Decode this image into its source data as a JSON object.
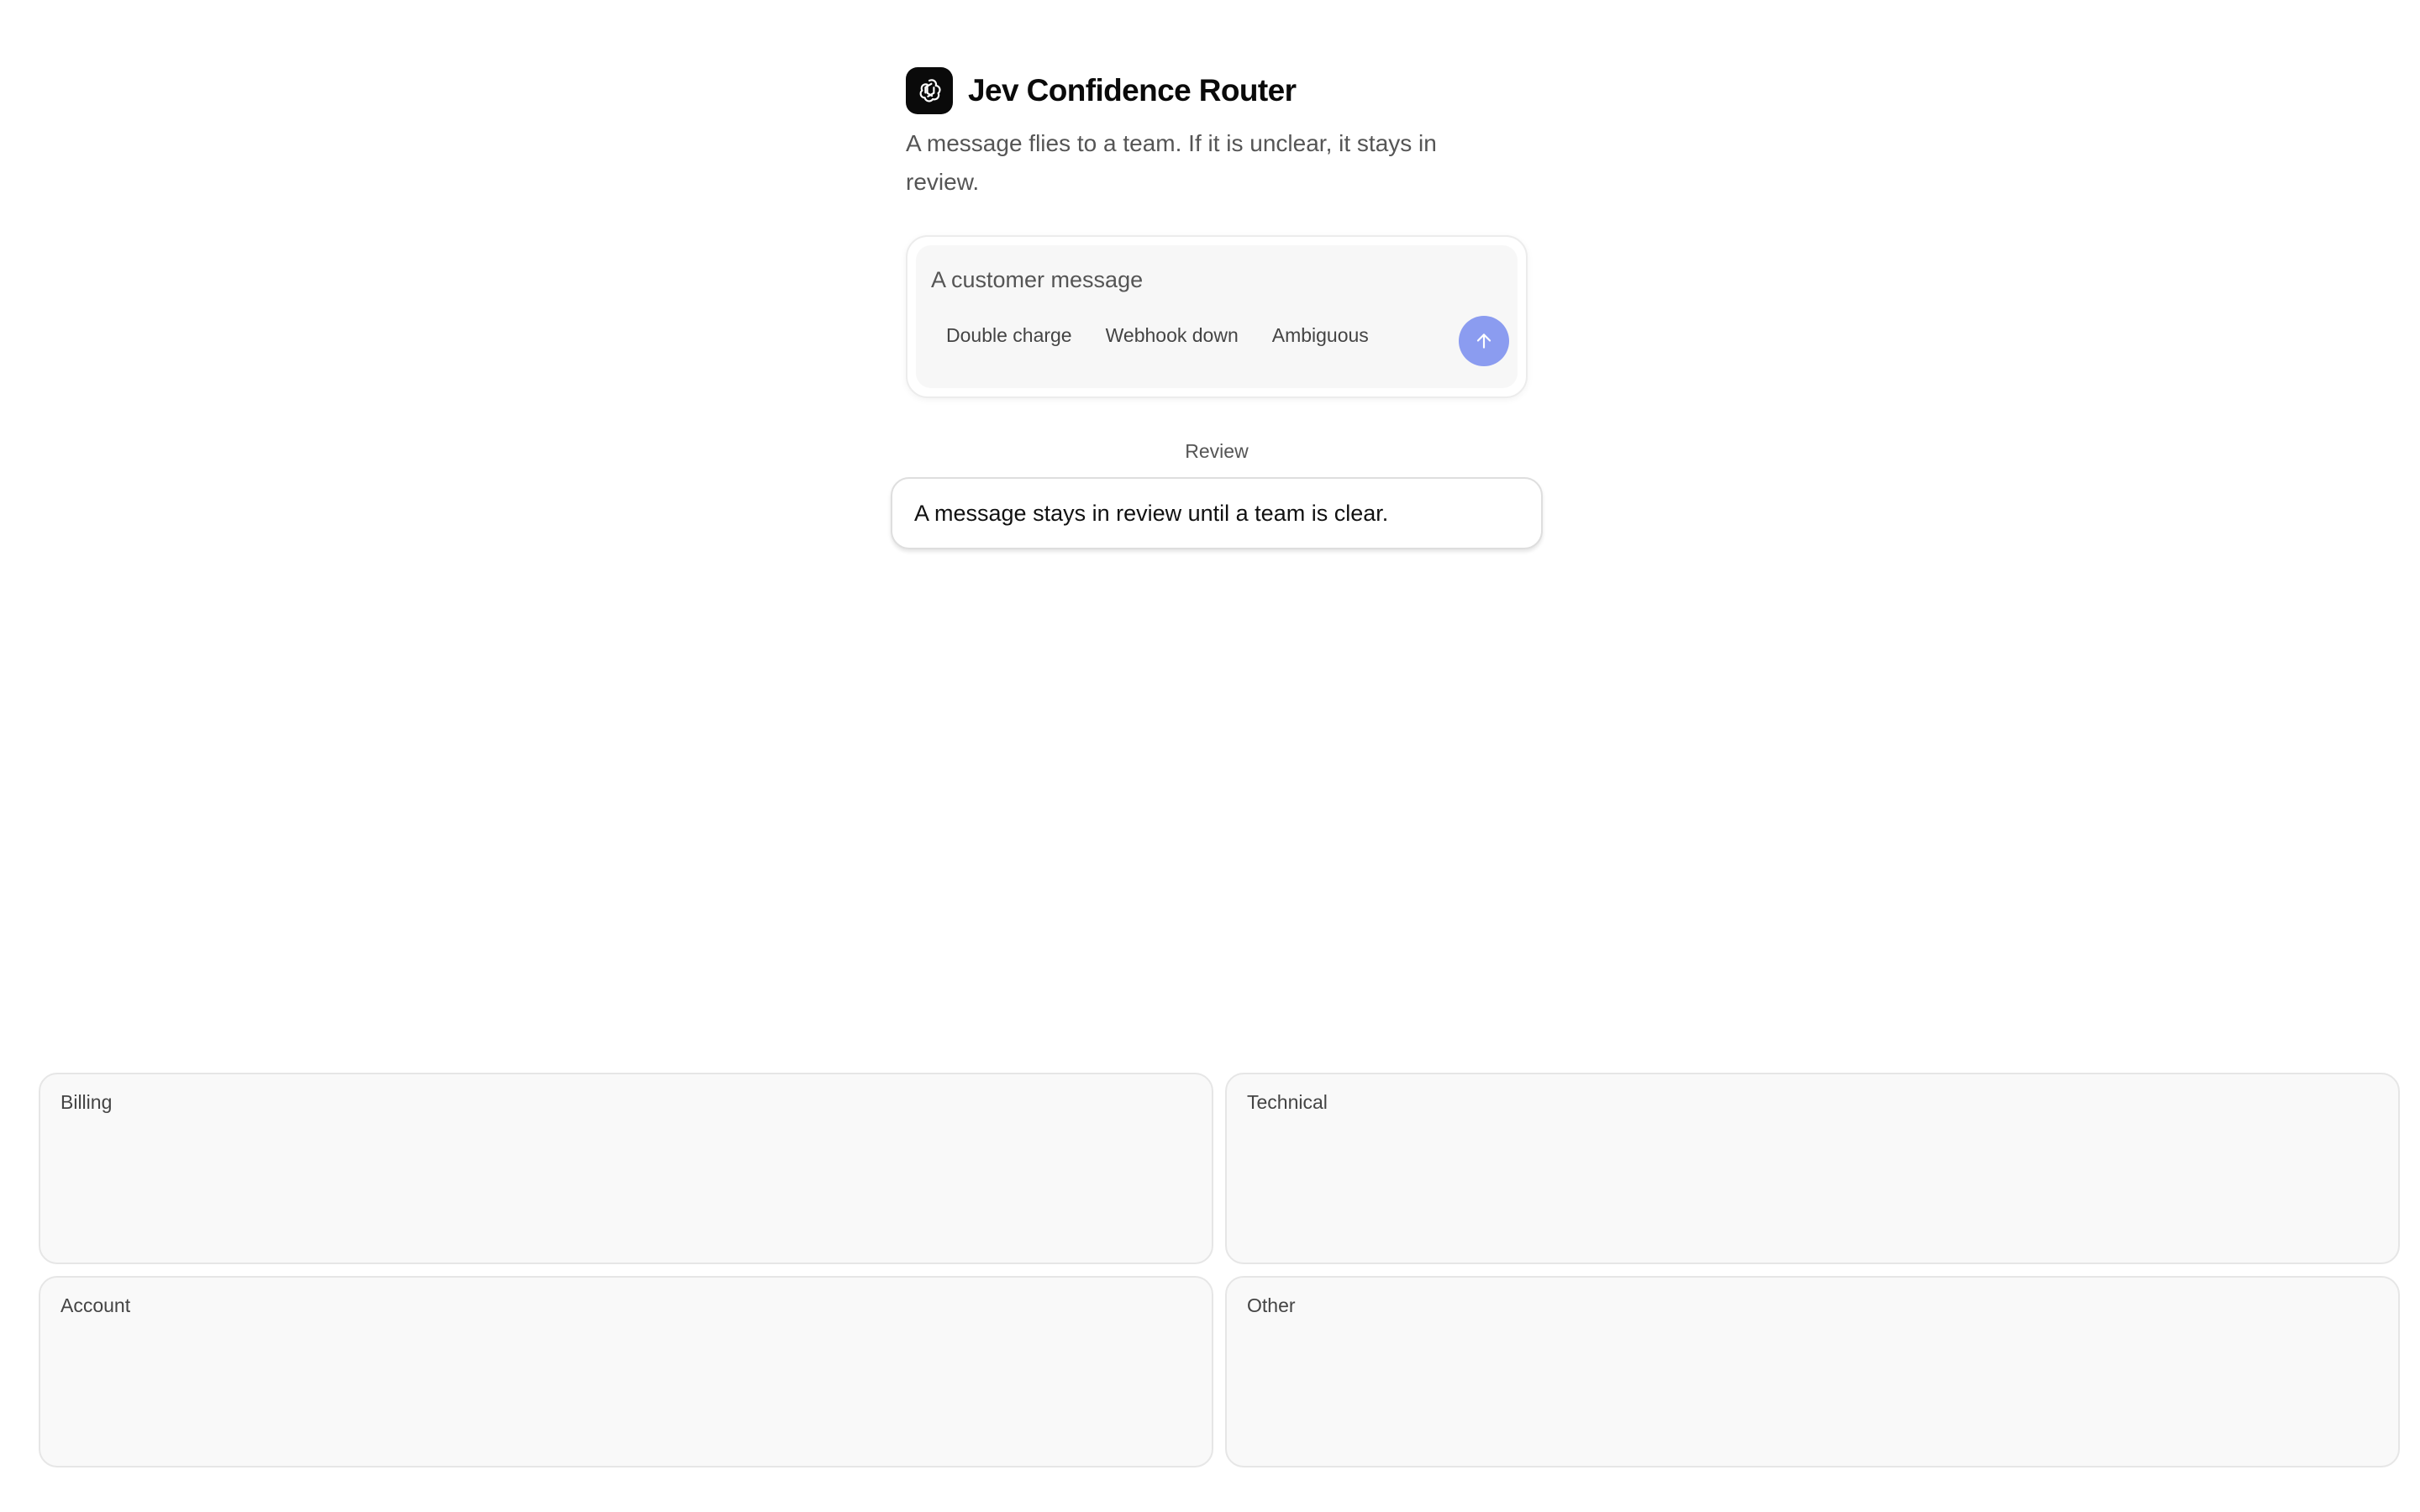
{
  "app": {
    "title": "Jev Confidence Router",
    "subtitle": "A message flies to a team. If it is unclear, it stays in review."
  },
  "composer": {
    "placeholder": "A customer message",
    "value": "",
    "chips": [
      "Double charge",
      "Webhook down",
      "Ambiguous"
    ],
    "send_icon": "arrow-up-icon",
    "send_color": "#8b9cf0"
  },
  "review": {
    "label": "Review",
    "message": "A message stays in review until a team is clear."
  },
  "bins": [
    {
      "label": "Billing"
    },
    {
      "label": "Technical"
    },
    {
      "label": "Account"
    },
    {
      "label": "Other"
    }
  ],
  "icons": {
    "logo": "openai-logo-icon"
  }
}
